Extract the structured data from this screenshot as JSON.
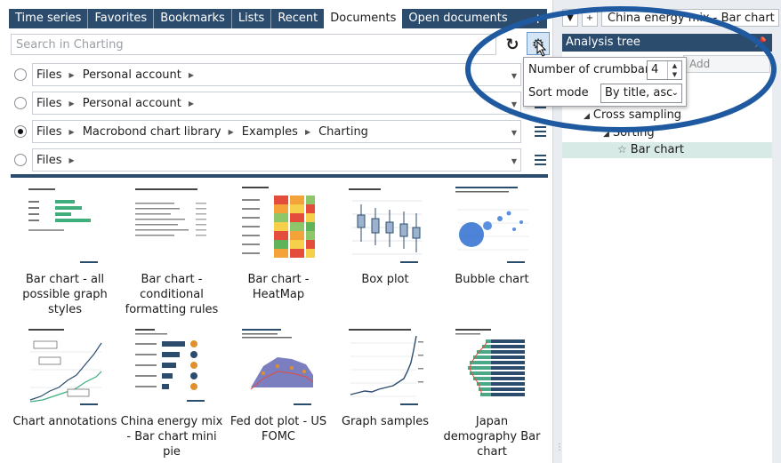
{
  "tabs": [
    {
      "label": "Time series"
    },
    {
      "label": "Favorites"
    },
    {
      "label": "Bookmarks"
    },
    {
      "label": "Lists"
    },
    {
      "label": "Recent"
    },
    {
      "label": "Documents"
    },
    {
      "label": "Open documents"
    }
  ],
  "tab_add_label": "+",
  "search": {
    "placeholder": "Search in Charting",
    "value": ""
  },
  "crumb_rows": [
    {
      "checked": false,
      "crumbs": [
        "Files",
        "Personal account"
      ]
    },
    {
      "checked": false,
      "crumbs": [
        "Files",
        "Personal account"
      ]
    },
    {
      "checked": true,
      "crumbs": [
        "Files",
        "Macrobond chart library",
        "Examples",
        "Charting"
      ]
    },
    {
      "checked": false,
      "crumbs": [
        "Files"
      ]
    }
  ],
  "documents": [
    {
      "label": "Bar chart - all possible graph styles",
      "thumb": "bars"
    },
    {
      "label": "Bar chart - conditional formatting rules",
      "thumb": "table"
    },
    {
      "label": "Bar chart - HeatMap",
      "thumb": "heatmap"
    },
    {
      "label": "Box plot",
      "thumb": "boxplot"
    },
    {
      "label": "Bubble chart",
      "thumb": "bubble"
    },
    {
      "label": "Chart annotations",
      "thumb": "annotations"
    },
    {
      "label": "China energy mix - Bar chart mini pie",
      "thumb": "pies"
    },
    {
      "label": "Fed dot plot - US FOMC",
      "thumb": "dotplot"
    },
    {
      "label": "Graph samples",
      "thumb": "line"
    },
    {
      "label": "Japan demography Bar chart",
      "thumb": "pyramid"
    }
  ],
  "doc_bar": {
    "down_label": "▼",
    "add_label": "+",
    "title": "China energy mix - Bar chart mini"
  },
  "analysis_tree": {
    "header": "Analysis tree",
    "add_placeholder": "Add",
    "items": [
      {
        "label": "Cross sampling"
      },
      {
        "label": "Sorting"
      },
      {
        "label": "Bar chart"
      }
    ]
  },
  "popup": {
    "crumbbars_label": "Number of crumbbars",
    "crumbbars_value": "4",
    "sort_label": "Sort mode",
    "sort_value": "By title, asc"
  },
  "colors": {
    "navy": "#2c4c6e",
    "annotation": "#1f5aa0",
    "selected_row": "#d8eae6"
  }
}
